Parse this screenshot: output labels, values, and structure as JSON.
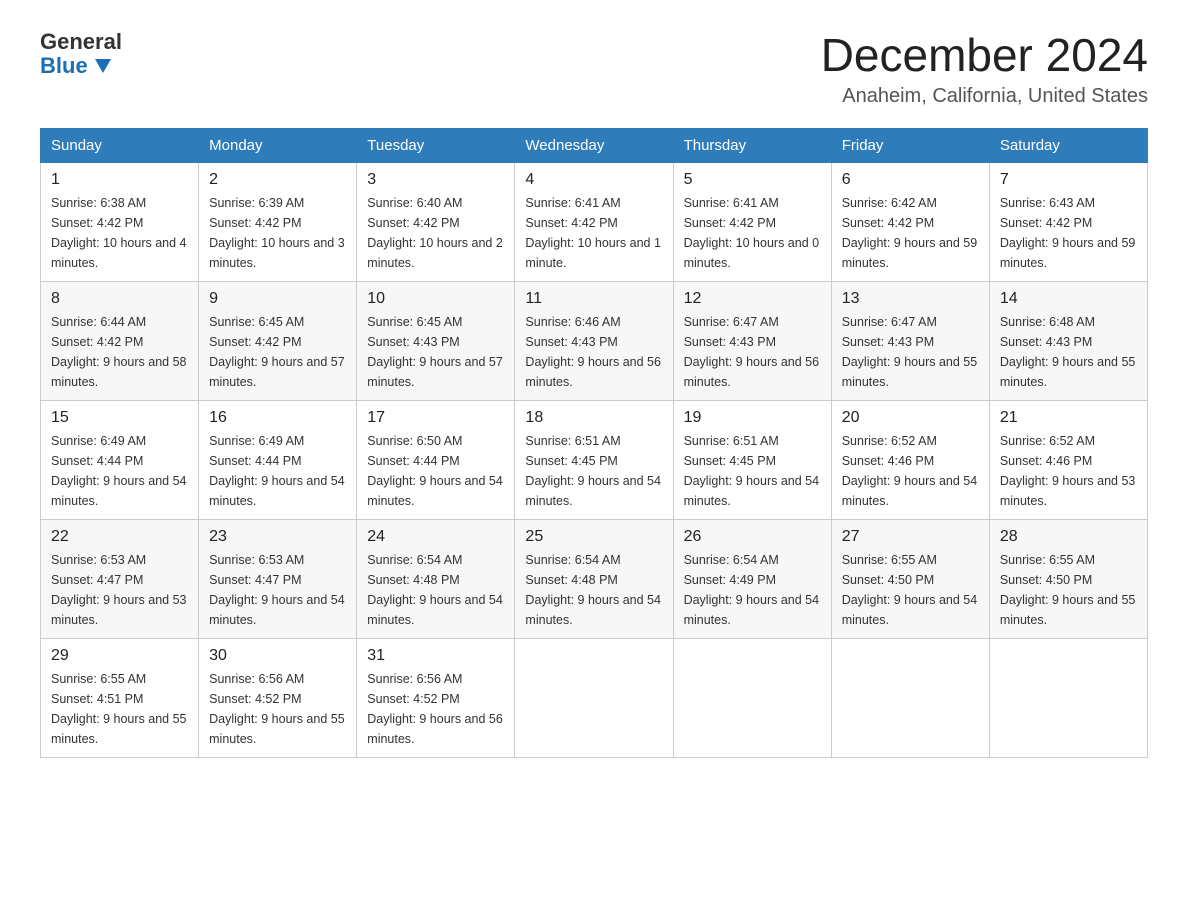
{
  "header": {
    "logo": {
      "text_general": "General",
      "text_blue": "Blue",
      "arrow_unicode": "▼"
    },
    "title": "December 2024",
    "location": "Anaheim, California, United States"
  },
  "days_of_week": [
    "Sunday",
    "Monday",
    "Tuesday",
    "Wednesday",
    "Thursday",
    "Friday",
    "Saturday"
  ],
  "weeks": [
    [
      {
        "day": "1",
        "sunrise": "6:38 AM",
        "sunset": "4:42 PM",
        "daylight": "10 hours and 4 minutes."
      },
      {
        "day": "2",
        "sunrise": "6:39 AM",
        "sunset": "4:42 PM",
        "daylight": "10 hours and 3 minutes."
      },
      {
        "day": "3",
        "sunrise": "6:40 AM",
        "sunset": "4:42 PM",
        "daylight": "10 hours and 2 minutes."
      },
      {
        "day": "4",
        "sunrise": "6:41 AM",
        "sunset": "4:42 PM",
        "daylight": "10 hours and 1 minute."
      },
      {
        "day": "5",
        "sunrise": "6:41 AM",
        "sunset": "4:42 PM",
        "daylight": "10 hours and 0 minutes."
      },
      {
        "day": "6",
        "sunrise": "6:42 AM",
        "sunset": "4:42 PM",
        "daylight": "9 hours and 59 minutes."
      },
      {
        "day": "7",
        "sunrise": "6:43 AM",
        "sunset": "4:42 PM",
        "daylight": "9 hours and 59 minutes."
      }
    ],
    [
      {
        "day": "8",
        "sunrise": "6:44 AM",
        "sunset": "4:42 PM",
        "daylight": "9 hours and 58 minutes."
      },
      {
        "day": "9",
        "sunrise": "6:45 AM",
        "sunset": "4:42 PM",
        "daylight": "9 hours and 57 minutes."
      },
      {
        "day": "10",
        "sunrise": "6:45 AM",
        "sunset": "4:43 PM",
        "daylight": "9 hours and 57 minutes."
      },
      {
        "day": "11",
        "sunrise": "6:46 AM",
        "sunset": "4:43 PM",
        "daylight": "9 hours and 56 minutes."
      },
      {
        "day": "12",
        "sunrise": "6:47 AM",
        "sunset": "4:43 PM",
        "daylight": "9 hours and 56 minutes."
      },
      {
        "day": "13",
        "sunrise": "6:47 AM",
        "sunset": "4:43 PM",
        "daylight": "9 hours and 55 minutes."
      },
      {
        "day": "14",
        "sunrise": "6:48 AM",
        "sunset": "4:43 PM",
        "daylight": "9 hours and 55 minutes."
      }
    ],
    [
      {
        "day": "15",
        "sunrise": "6:49 AM",
        "sunset": "4:44 PM",
        "daylight": "9 hours and 54 minutes."
      },
      {
        "day": "16",
        "sunrise": "6:49 AM",
        "sunset": "4:44 PM",
        "daylight": "9 hours and 54 minutes."
      },
      {
        "day": "17",
        "sunrise": "6:50 AM",
        "sunset": "4:44 PM",
        "daylight": "9 hours and 54 minutes."
      },
      {
        "day": "18",
        "sunrise": "6:51 AM",
        "sunset": "4:45 PM",
        "daylight": "9 hours and 54 minutes."
      },
      {
        "day": "19",
        "sunrise": "6:51 AM",
        "sunset": "4:45 PM",
        "daylight": "9 hours and 54 minutes."
      },
      {
        "day": "20",
        "sunrise": "6:52 AM",
        "sunset": "4:46 PM",
        "daylight": "9 hours and 54 minutes."
      },
      {
        "day": "21",
        "sunrise": "6:52 AM",
        "sunset": "4:46 PM",
        "daylight": "9 hours and 53 minutes."
      }
    ],
    [
      {
        "day": "22",
        "sunrise": "6:53 AM",
        "sunset": "4:47 PM",
        "daylight": "9 hours and 53 minutes."
      },
      {
        "day": "23",
        "sunrise": "6:53 AM",
        "sunset": "4:47 PM",
        "daylight": "9 hours and 54 minutes."
      },
      {
        "day": "24",
        "sunrise": "6:54 AM",
        "sunset": "4:48 PM",
        "daylight": "9 hours and 54 minutes."
      },
      {
        "day": "25",
        "sunrise": "6:54 AM",
        "sunset": "4:48 PM",
        "daylight": "9 hours and 54 minutes."
      },
      {
        "day": "26",
        "sunrise": "6:54 AM",
        "sunset": "4:49 PM",
        "daylight": "9 hours and 54 minutes."
      },
      {
        "day": "27",
        "sunrise": "6:55 AM",
        "sunset": "4:50 PM",
        "daylight": "9 hours and 54 minutes."
      },
      {
        "day": "28",
        "sunrise": "6:55 AM",
        "sunset": "4:50 PM",
        "daylight": "9 hours and 55 minutes."
      }
    ],
    [
      {
        "day": "29",
        "sunrise": "6:55 AM",
        "sunset": "4:51 PM",
        "daylight": "9 hours and 55 minutes."
      },
      {
        "day": "30",
        "sunrise": "6:56 AM",
        "sunset": "4:52 PM",
        "daylight": "9 hours and 55 minutes."
      },
      {
        "day": "31",
        "sunrise": "6:56 AM",
        "sunset": "4:52 PM",
        "daylight": "9 hours and 56 minutes."
      },
      null,
      null,
      null,
      null
    ]
  ],
  "labels": {
    "sunrise": "Sunrise:",
    "sunset": "Sunset:",
    "daylight": "Daylight:"
  }
}
